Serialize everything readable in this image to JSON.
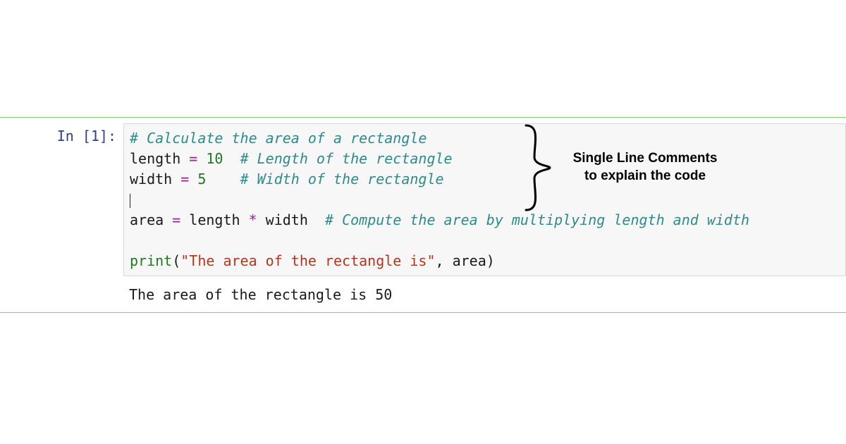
{
  "cell": {
    "prompt_label": "In [1]:",
    "code": {
      "line1_comment": "# Calculate the area of a rectangle",
      "line2_var": "length",
      "line2_op": " = ",
      "line2_val": "10",
      "line2_pad": "  ",
      "line2_comment": "# Length of the rectangle",
      "line3_var": "width",
      "line3_op": " = ",
      "line3_val": "5",
      "line3_pad": "    ",
      "line3_comment": "# Width of the rectangle",
      "line5_var": "area",
      "line5_op1": " = ",
      "line5_a": "length",
      "line5_mul": " * ",
      "line5_b": "width",
      "line5_pad": "  ",
      "line5_comment": "# Compute the area by multiplying length and width",
      "line7_fn": "print",
      "line7_open": "(",
      "line7_str": "\"The area of the rectangle is\"",
      "line7_comma": ", ",
      "line7_arg": "area",
      "line7_close": ")"
    },
    "output": "The area of the rectangle is 50"
  },
  "annotation": {
    "line1": "Single Line Comments",
    "line2": "to explain the code"
  }
}
